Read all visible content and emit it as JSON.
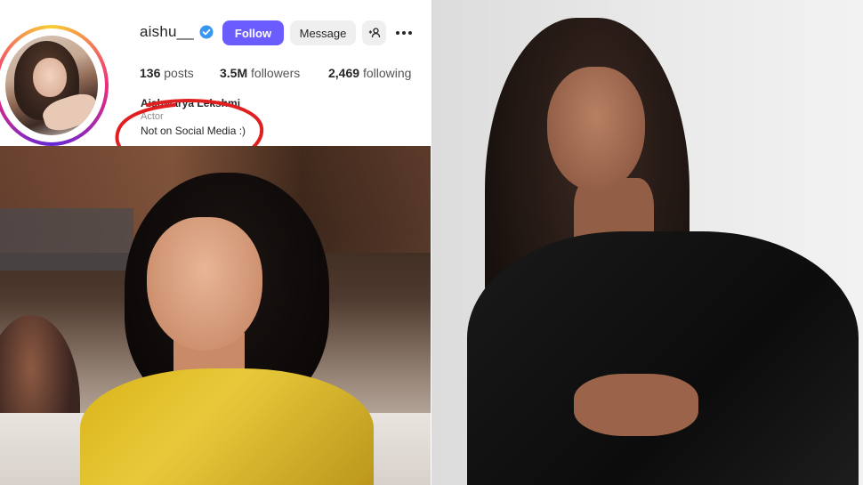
{
  "profile": {
    "username": "aishu__",
    "follow_label": "Follow",
    "message_label": "Message",
    "stats": {
      "posts_count": "136",
      "posts_label": "posts",
      "followers_count": "3.5M",
      "followers_label": "followers",
      "following_count": "2,469",
      "following_label": "following"
    },
    "full_name": "Aishwarya Lekshmi",
    "category": "Actor",
    "bio": "Not on Social Media :)"
  },
  "colors": {
    "follow_button": "#6b5cff",
    "verified_badge": "#3897f0",
    "annotation": "#e02020"
  },
  "icons": [
    "verified-icon",
    "add-user-icon",
    "more-options-icon"
  ]
}
